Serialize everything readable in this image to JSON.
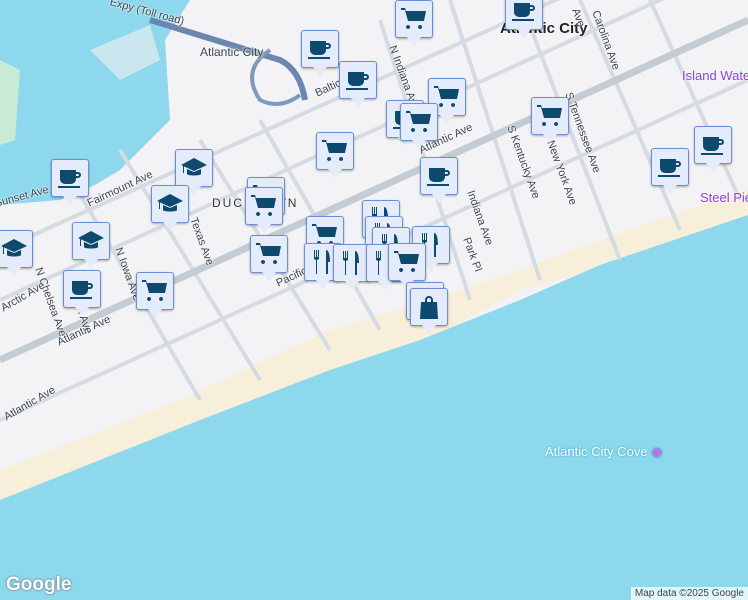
{
  "map": {
    "labels": {
      "expressway": "Expy (Toll road)",
      "station": "Atlantic City",
      "city": "Atlantic City",
      "neighborhood": "DUCKTOWN",
      "island_waterpark": "Island Waterpark at Showboat",
      "steel_pier": "Steel Pier",
      "cove": "Atlantic City Cove",
      "streets": [
        "Baltic Ave",
        "Arctic Ave",
        "Atlantic Ave",
        "N Indiana Ave",
        "Indiana Ave",
        "Park Pl",
        "S Kentucky Ave",
        "S Tennessee Ave",
        "New York Ave",
        "Pacific Ave",
        "Fairmount Ave",
        "Texas Ave",
        "N Iowa Ave",
        "N Chelsea Ave",
        "Sunset Ave",
        "Arctic Ave",
        "Atlantic Ave",
        "Atlantic Ave",
        "N Morton Ave",
        "Carolina Ave",
        "Ave"
      ]
    },
    "markers": [
      {
        "type": "coffee"
      },
      {
        "type": "coffee"
      },
      {
        "type": "cart"
      },
      {
        "type": "coffee"
      },
      {
        "type": "cart"
      },
      {
        "type": "coffee"
      },
      {
        "type": "cart"
      },
      {
        "type": "cart"
      },
      {
        "type": "coffee"
      },
      {
        "type": "cart"
      },
      {
        "type": "coffee"
      },
      {
        "type": "coffee"
      },
      {
        "type": "graduation-cap"
      },
      {
        "type": "graduation-cap"
      },
      {
        "type": "coffee"
      },
      {
        "type": "cart"
      },
      {
        "type": "cart"
      },
      {
        "type": "graduation-cap"
      },
      {
        "type": "graduation-cap"
      },
      {
        "type": "coffee"
      },
      {
        "type": "cart"
      },
      {
        "type": "cart"
      },
      {
        "type": "cart"
      },
      {
        "type": "fork-knife"
      },
      {
        "type": "fork-knife"
      },
      {
        "type": "fork-knife"
      },
      {
        "type": "fork-knife"
      },
      {
        "type": "fork-knife"
      },
      {
        "type": "fork-knife"
      },
      {
        "type": "fork-knife"
      },
      {
        "type": "cart"
      },
      {
        "type": "shopping-bag"
      },
      {
        "type": "shopping-bag"
      }
    ],
    "logo": "Google",
    "attribution": "Map data ©2025 Google",
    "colors": {
      "water": "#8dd8ec",
      "land": "#f3f2f4",
      "beach": "#f7efd9",
      "marker_bg": "#e4ecfb",
      "marker_icon": "#0d4a6e",
      "poi": "#8b3ee0"
    }
  }
}
